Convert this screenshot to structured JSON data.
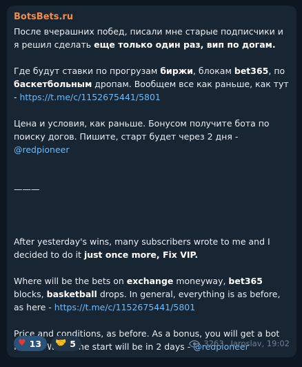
{
  "message": {
    "sender": "BotsBets.ru",
    "ru_p1_a": "После вчерашних побед, писали мне старые подписчики и я решил сделать ",
    "ru_p1_b": "еще только один раз, вип по догам.",
    "ru_p2_a": "Где будут ставки по прогрузам ",
    "ru_p2_b": "биржи",
    "ru_p2_c": ", блокам ",
    "ru_p2_d": "bet365",
    "ru_p2_e": ", по ",
    "ru_p2_f": "баскетбольным",
    "ru_p2_g": " дропам. Вообщем все как раньше, как тут - ",
    "ru_link": "https://t.me/c/1152675441/5801",
    "ru_p3_a": "Цена и условия, как раньше. Бонусом получите бота по поиску догов.  Пишите, старт будет через 2 дня - ",
    "ru_mention": "@redpioneer",
    "divider": "———",
    "en_p1_a": "After yesterday's wins, many subscribers wrote to me and I decided to do it ",
    "en_p1_b": "just once more, Fix VIP.",
    "en_p2_a": "Where will be the bets on  ",
    "en_p2_b": "exchange",
    "en_p2_c": " moneyway, ",
    "en_p2_d": "bet365",
    "en_p2_e": " blocks, ",
    "en_p2_f": "basketball",
    "en_p2_g": " drops. In general, everything is as before, as here - ",
    "en_link": "https://t.me/c/1152675441/5801",
    "en_p3_a": "Price and conditions, as before. As a bonus, you will get a bot  fix-bot. Write, the start will be in 2 days - ",
    "en_mention": "@redpioneer"
  },
  "reactions": [
    {
      "emoji": "heart-icon",
      "glyph": "♥",
      "count": "13"
    },
    {
      "emoji": "handshake-icon",
      "glyph": "🤝",
      "count": "5"
    }
  ],
  "meta": {
    "views": "3263",
    "author_time": "Iaroslav, 19:02"
  },
  "colors": {
    "background": "#0e1621",
    "bubble": "#182533",
    "sender": "#f28c48",
    "link": "#71baf5",
    "reaction_active": "#2b5278"
  }
}
